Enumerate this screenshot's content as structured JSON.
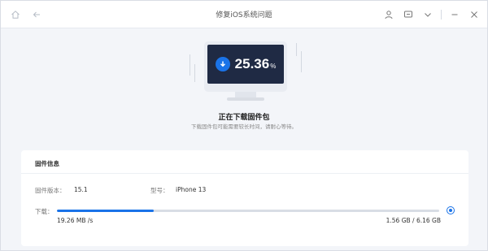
{
  "titlebar": {
    "title": "修复iOS系统问题",
    "icons": [
      "home-icon",
      "back-arrow-icon",
      "user-icon",
      "feedback-icon",
      "chevron-down-icon",
      "minimize-icon",
      "close-icon"
    ]
  },
  "progress": {
    "percent_value": "25.36",
    "percent_sign": "%",
    "fraction": 0.2536,
    "status_title": "正在下载固件包",
    "status_subtitle": "下载固件包可能需要较长时间，请耐心等待。"
  },
  "info": {
    "title": "固件信息",
    "firmware_label": "固件版本：",
    "firmware_value": "15.1",
    "model_label": "型号：",
    "model_value": "iPhone 13",
    "download_label": "下载：",
    "speed": "19.26 MB /s",
    "size": "1.56 GB / 6.16 GB"
  },
  "colors": {
    "accent": "#1a73e8",
    "screen": "#1f2a44",
    "background": "#f3f5f9"
  }
}
